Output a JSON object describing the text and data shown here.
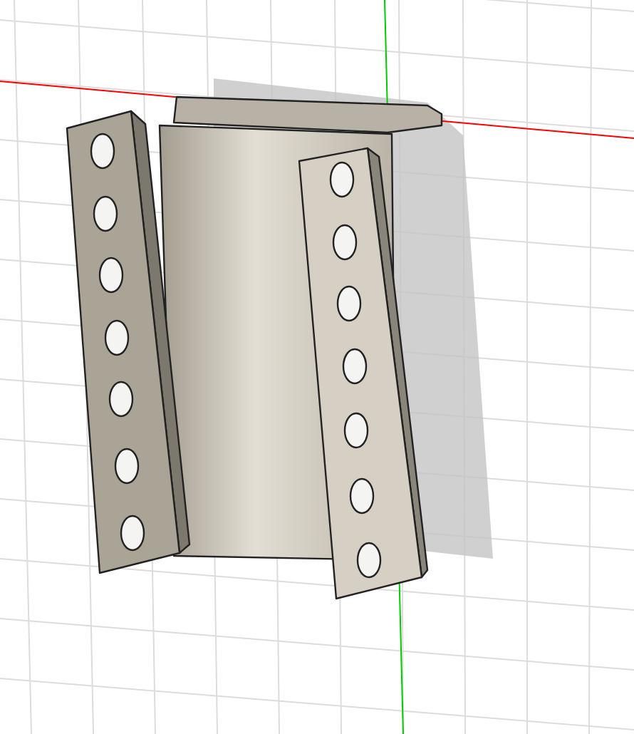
{
  "viewport": {
    "axes": [
      {
        "kind": "x",
        "color": "#ff0000"
      },
      {
        "kind": "y",
        "color": "#00cc00"
      }
    ]
  }
}
